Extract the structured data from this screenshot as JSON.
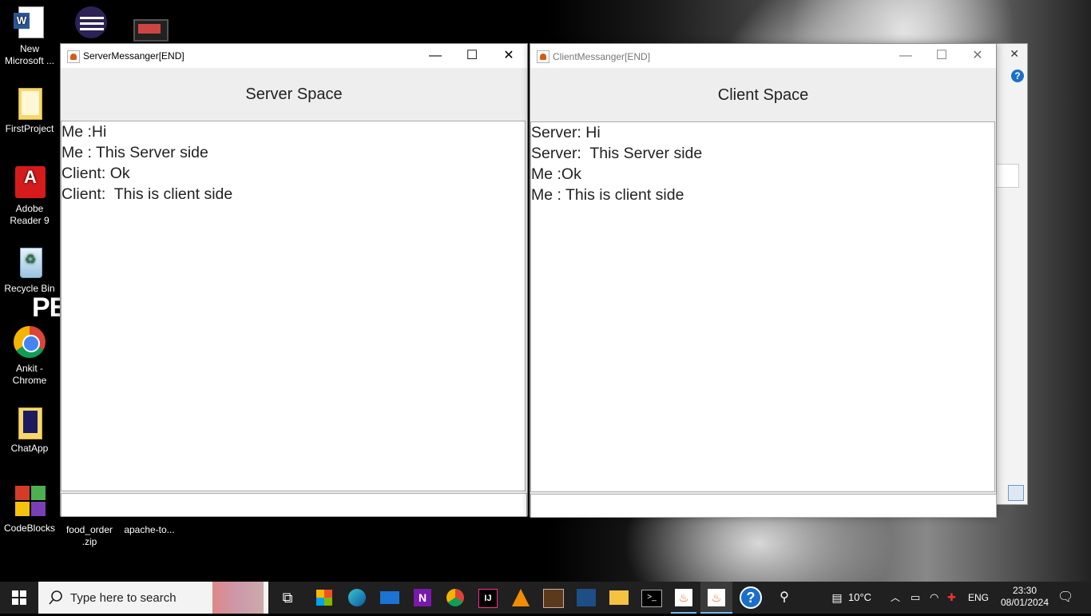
{
  "desktop": {
    "icons": [
      {
        "label": "New Microsoft ...",
        "icon": "word-document-icon"
      },
      {
        "label": "",
        "icon": "eclipse-icon"
      },
      {
        "label": "",
        "icon": "video-file-icon"
      },
      {
        "label": "FirstProject",
        "icon": "folder-icon"
      },
      {
        "label": "Adobe Reader 9",
        "icon": "adobe-reader-icon"
      },
      {
        "label": "Recycle Bin",
        "icon": "recycle-bin-icon"
      },
      {
        "label": "Ankit - Chrome",
        "icon": "chrome-profile-icon"
      },
      {
        "label": "ChatApp",
        "icon": "folder-icon"
      },
      {
        "label": "CodeBlocks",
        "icon": "codeblocks-icon"
      },
      {
        "label": "food_order .zip",
        "icon": "zip-file-icon"
      },
      {
        "label": "apache-to...",
        "icon": "zip-file-icon"
      }
    ],
    "wallpaper_text": "PE"
  },
  "server_window": {
    "title": "ServerMessanger[END]",
    "header": "Server Space",
    "messages": [
      "Me :Hi",
      "Me : This Server side",
      "Client: Ok",
      "Client:  This is client side"
    ],
    "input_value": ""
  },
  "client_window": {
    "title": "ClientMessanger[END]",
    "header": "Client Space",
    "messages": [
      "Server: Hi",
      "Server:  This Server side",
      "Me :Ok",
      "Me : This is client side"
    ],
    "input_value": ""
  },
  "window_controls": {
    "minimize": "—",
    "maximize": "☐",
    "close": "✕"
  },
  "taskbar": {
    "search_placeholder": "Type here to search",
    "apps": [
      "task-view-icon",
      "store-icon",
      "edge-icon",
      "mail-icon",
      "onenote-icon",
      "chrome-icon",
      "intellij-icon",
      "vlc-icon",
      "game-icon",
      "mysql-workbench-icon",
      "file-explorer-icon",
      "terminal-icon",
      "java-icon",
      "java-icon",
      "help-icon",
      "people-icon"
    ],
    "weather": "10°C",
    "language": "ENG",
    "time": "23:30",
    "date": "08/01/2024"
  },
  "colors": {
    "taskbar": "#202020",
    "window_bg": "#eeeeee",
    "accent": "#76b9ed"
  }
}
